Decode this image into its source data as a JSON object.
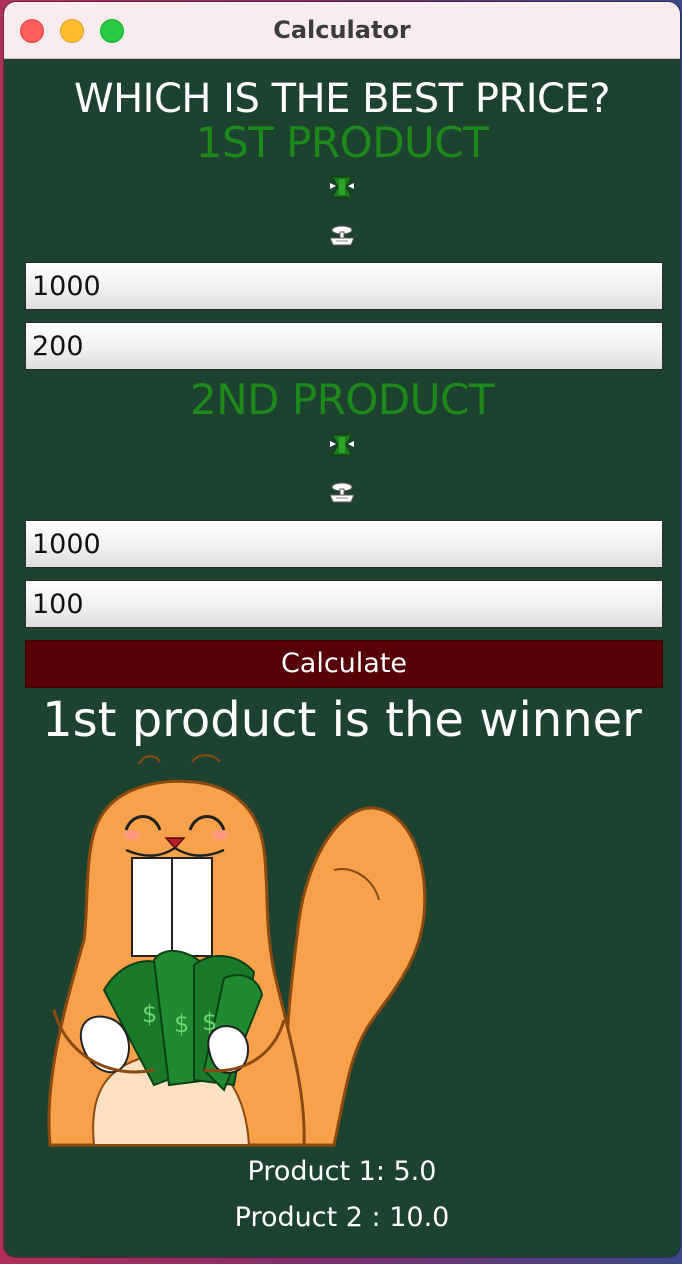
{
  "window": {
    "title": "Calculator"
  },
  "header": {
    "question": "WHICH IS THE BEST PRICE?"
  },
  "product1": {
    "heading": "1ST PRODUCT",
    "price_value": "1000",
    "quantity_value": "200"
  },
  "product2": {
    "heading": "2ND PRODUCT",
    "price_value": "1000",
    "quantity_value": "100"
  },
  "actions": {
    "calculate_label": "Calculate"
  },
  "result": {
    "winner_text": "1st product is the winner",
    "product1_line": "Product 1: 5.0",
    "product2_line": "Product 2 : 10.0"
  },
  "colors": {
    "window_bg": "#1e4230",
    "product_heading": "#1b8a1b",
    "button_bg": "#560006",
    "titlebar_bg": "#f8ecef"
  },
  "icons": [
    "money-bag-icon",
    "scale-icon",
    "beaver-holding-money-illustration"
  ]
}
